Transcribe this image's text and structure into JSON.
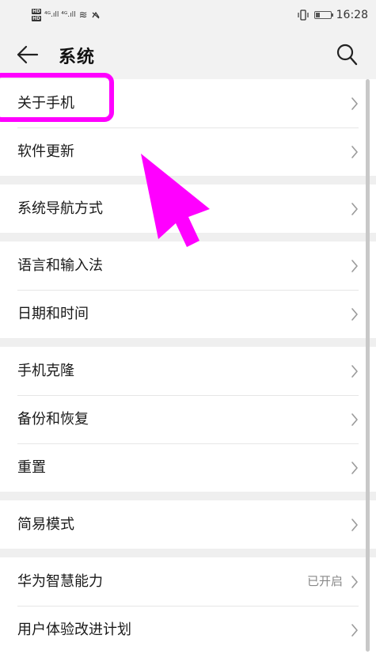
{
  "status_bar": {
    "network_left": "⁴ᴳ.ıll ⁴ᴳ.ıll",
    "wifi_glyph": "≋",
    "time": "16:28",
    "battery_level": 0.3
  },
  "header": {
    "title": "系统"
  },
  "groups": [
    {
      "items": [
        {
          "label": "关于手机",
          "value": ""
        },
        {
          "label": "软件更新",
          "value": ""
        }
      ]
    },
    {
      "items": [
        {
          "label": "系统导航方式",
          "value": ""
        }
      ]
    },
    {
      "items": [
        {
          "label": "语言和输入法",
          "value": ""
        },
        {
          "label": "日期和时间",
          "value": ""
        }
      ]
    },
    {
      "items": [
        {
          "label": "手机克隆",
          "value": ""
        },
        {
          "label": "备份和恢复",
          "value": ""
        },
        {
          "label": "重置",
          "value": ""
        }
      ]
    },
    {
      "items": [
        {
          "label": "简易模式",
          "value": ""
        }
      ]
    },
    {
      "items": [
        {
          "label": "华为智慧能力",
          "value": "已开启"
        },
        {
          "label": "用户体验改进计划",
          "value": ""
        }
      ]
    }
  ],
  "colors": {
    "annotation": "#ff00ff",
    "background": "#efefef",
    "row_background": "#ffffff"
  },
  "icons": {
    "back": "back-arrow-icon",
    "search": "search-icon",
    "chevron": "chevron-right-icon"
  }
}
